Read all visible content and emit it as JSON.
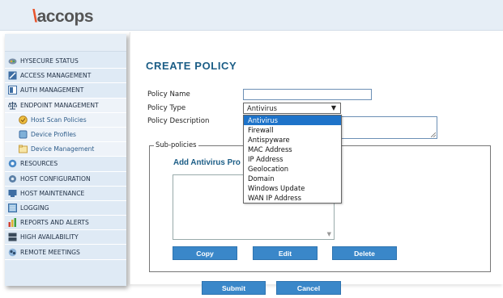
{
  "brand": {
    "logo_text": "accops"
  },
  "sidebar": {
    "items": [
      {
        "label": "HYSECURE STATUS",
        "icon": "status-icon"
      },
      {
        "label": "ACCESS MANAGEMENT",
        "icon": "access-icon"
      },
      {
        "label": "AUTH MANAGEMENT",
        "icon": "auth-icon"
      },
      {
        "label": "ENDPOINT MANAGEMENT",
        "icon": "scale-icon"
      },
      {
        "label": "Host Scan Policies",
        "icon": "scan-icon"
      },
      {
        "label": "Device Profiles",
        "icon": "device-icon"
      },
      {
        "label": "Device Management",
        "icon": "folder-icon"
      },
      {
        "label": "RESOURCES",
        "icon": "resources-icon"
      },
      {
        "label": "HOST CONFIGURATION",
        "icon": "config-icon"
      },
      {
        "label": "HOST MAINTENANCE",
        "icon": "maintenance-icon"
      },
      {
        "label": "LOGGING",
        "icon": "logging-icon"
      },
      {
        "label": "REPORTS AND ALERTS",
        "icon": "reports-icon"
      },
      {
        "label": "HIGH AVAILABILITY",
        "icon": "ha-icon"
      },
      {
        "label": "REMOTE MEETINGS",
        "icon": "meetings-icon"
      }
    ]
  },
  "form": {
    "title": "CREATE POLICY",
    "policy_name_label": "Policy Name",
    "policy_name_value": "",
    "policy_type_label": "Policy Type",
    "policy_type_value": "Antivirus",
    "policy_description_label": "Policy Description",
    "policy_description_value": "",
    "subpolicies_legend": "Sub-policies",
    "add_title": "Add Antivirus Pro",
    "copy_label": "Copy",
    "edit_label": "Edit",
    "delete_label": "Delete",
    "submit_label": "Submit",
    "cancel_label": "Cancel"
  },
  "policy_type_options": [
    "Antivirus",
    "Firewall",
    "Antispyware",
    "MAC Address",
    "IP Address",
    "Geolocation",
    "Domain",
    "Windows Update",
    "WAN IP Address"
  ],
  "colors": {
    "accent": "#1b5d86",
    "button": "#3a87c9",
    "selected_option": "#1e73c9",
    "logo_mark": "#e8542c"
  }
}
